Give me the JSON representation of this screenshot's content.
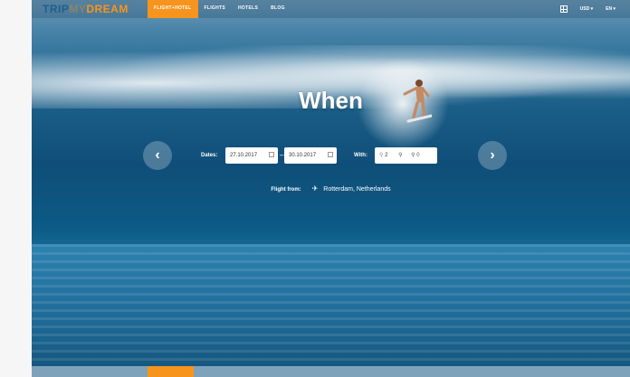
{
  "brand": {
    "logo_part1": "TRIP",
    "logo_part2": "MY",
    "logo_part3": "DREAM",
    "accent_color": "#f7941d",
    "brand_blue": "#1e5f8c"
  },
  "nav": {
    "items": [
      {
        "label": "FLIGHT+HOTEL",
        "active": true
      },
      {
        "label": "FLIGHTS",
        "active": false
      },
      {
        "label": "HOTELS",
        "active": false
      },
      {
        "label": "BLOG",
        "active": false
      }
    ]
  },
  "tools": {
    "grid_icon": "grid-icon",
    "currency": "USD ▾",
    "language": "EN ▾"
  },
  "hero": {
    "headline": "When",
    "dates_label": "Dates:",
    "date_from": "27.10.2017",
    "date_to": "30.10.2017",
    "date_separator": "–",
    "with_label": "With:",
    "adults": "2",
    "children": "",
    "infants": "0",
    "flight_from_label": "Flight from:",
    "flight_from_value": "Rotterdam, Netherlands",
    "prev_icon": "chevron-left-icon",
    "next_icon": "chevron-right-icon"
  }
}
